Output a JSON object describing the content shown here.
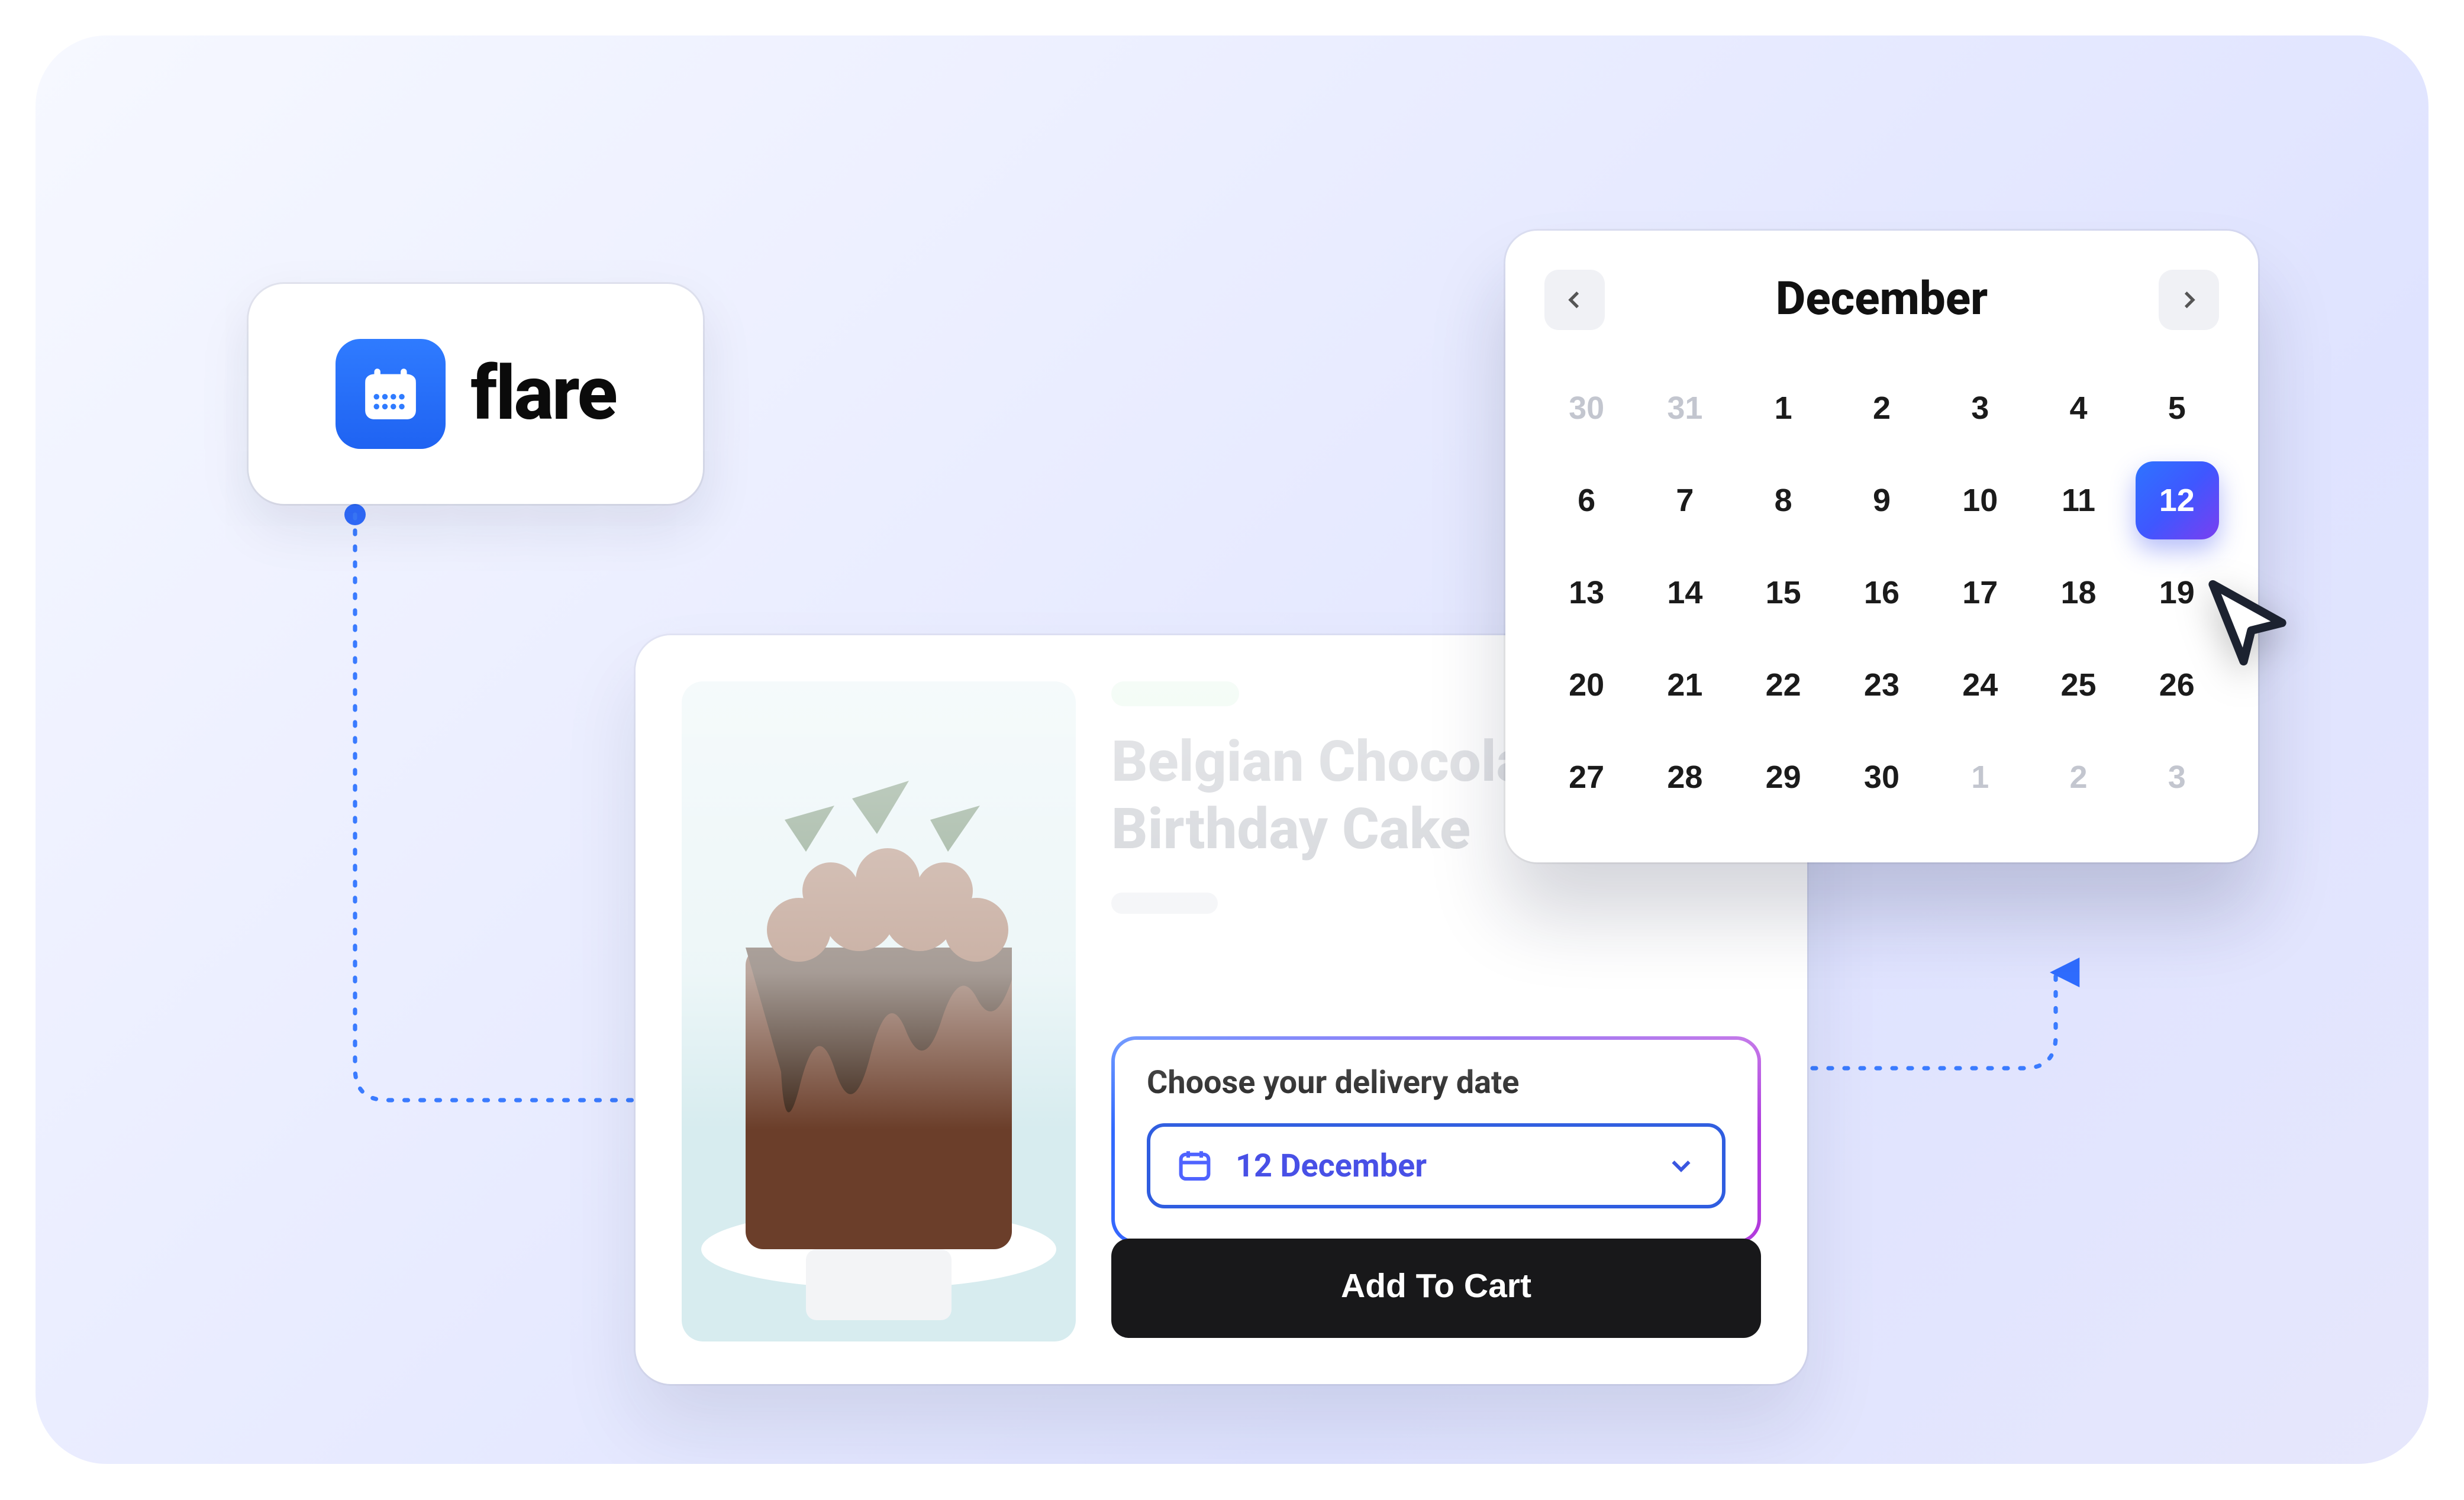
{
  "logo": {
    "word": "flare"
  },
  "product": {
    "title_line1": "Belgian Chocolate",
    "title_line2": "Birthday Cake",
    "date_label": "Choose your delivery date",
    "date_value": "12 December",
    "add_to_cart": "Add To Cart"
  },
  "calendar": {
    "month": "December",
    "selected": 12,
    "leading": [
      30,
      31
    ],
    "days": [
      1,
      2,
      3,
      4,
      5,
      6,
      7,
      8,
      9,
      10,
      11,
      12,
      13,
      14,
      15,
      16,
      17,
      18,
      19,
      20,
      21,
      22,
      23,
      24,
      25,
      26,
      27,
      28,
      29,
      30
    ],
    "trailing": [
      1,
      2,
      3
    ]
  },
  "colors": {
    "accent_blue": "#2f6cff",
    "accent_purple": "#7a3ff0"
  }
}
